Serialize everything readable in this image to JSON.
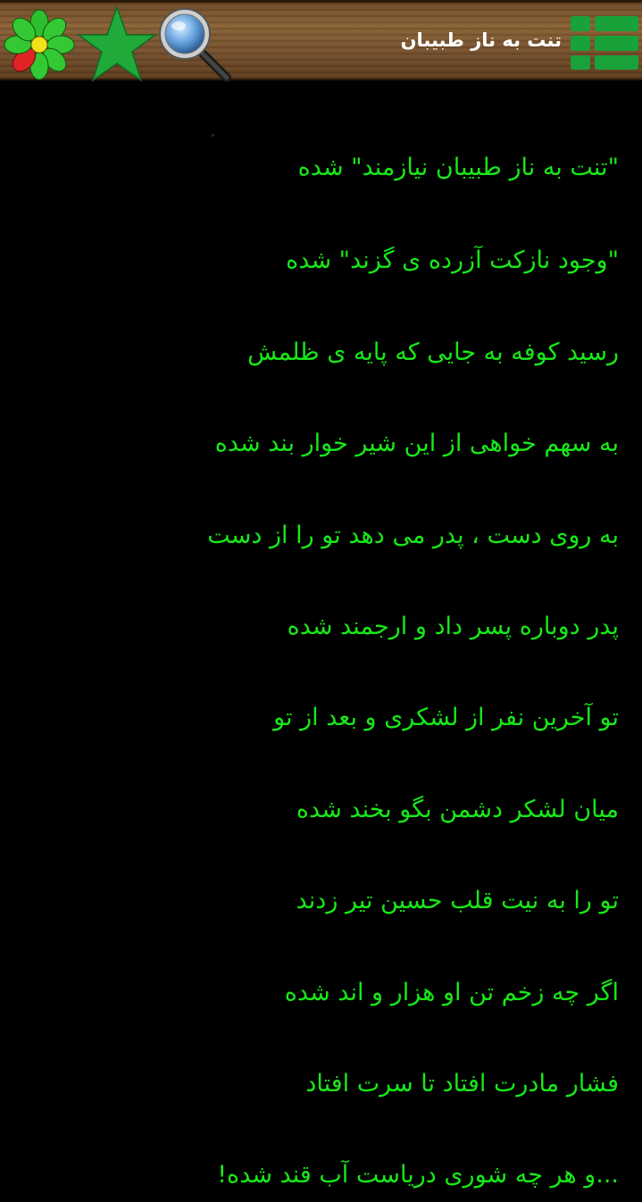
{
  "header": {
    "title": "تنت به ناز طبیبان",
    "icons": [
      "icq-flower-icon",
      "star-icon",
      "search-icon",
      "menu-grid-icon"
    ],
    "colors": {
      "bar_wood": "#7a5430",
      "menu_green": "#19a13a",
      "star_green": "#1faa3a"
    }
  },
  "poem": {
    "text_color": "#18e818",
    "lines": [
      "\"تنت به ناز طبیبان نیازمند\" شده",
      "\"وجود نازکت آزرده ی گزند\" شده",
      "رسید کوفه به جایی که پایه ی ظلمش",
      "به سهم خواهی از این شیر خوار بند شده",
      "به روی دست ، پدر می دهد تو را از دست",
      "پدر دوباره پسر داد و ارجمند شده",
      "تو آخرین نفر از لشکری و بعد از تو",
      "میان لشکر دشمن بگو بخند شده",
      "تو را به نیت قلب حسین تیر زدند",
      "اگر چه زخم تن او هزار و اند شده",
      "فشار مادرت افتاد تا سرت افتاد",
      "...و هر چه شوری دریاست آب قند شده!"
    ]
  }
}
